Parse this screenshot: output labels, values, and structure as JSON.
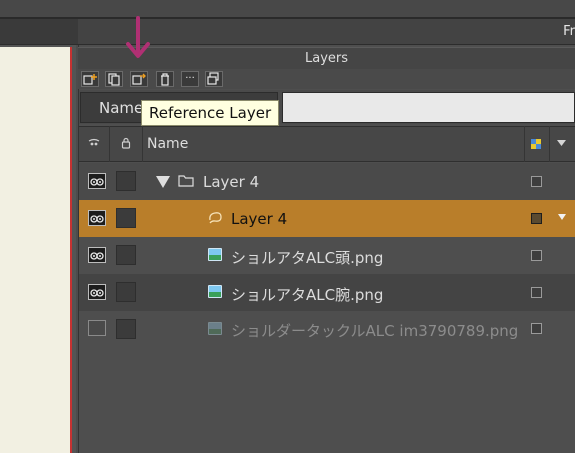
{
  "menu": {
    "right_text": "Fr"
  },
  "panel": {
    "title": "Layers"
  },
  "toolbar": {
    "more_glyph": "···"
  },
  "search": {
    "mode_label": "Name",
    "placeholder": "",
    "value": ""
  },
  "tooltip": {
    "text": "Reference Layer"
  },
  "columns": {
    "name": "Name"
  },
  "layers": [
    {
      "name": "Layer 4",
      "kind": "folder",
      "visible": true,
      "selected": false
    },
    {
      "name": "Layer 4",
      "kind": "vector",
      "visible": true,
      "selected": true
    },
    {
      "name": "ショルアタALC頭.png",
      "kind": "image",
      "visible": true,
      "selected": false
    },
    {
      "name": "ショルアタALC腕.png",
      "kind": "image",
      "visible": true,
      "selected": false
    },
    {
      "name": "ショルダータックルALC im3790789.png",
      "kind": "image",
      "visible": false,
      "selected": false
    }
  ],
  "colors": {
    "accent": "#b97e2a",
    "arrow": "#b03073",
    "panel": "#4e4e4e",
    "canvas": "#f2f0e2"
  }
}
